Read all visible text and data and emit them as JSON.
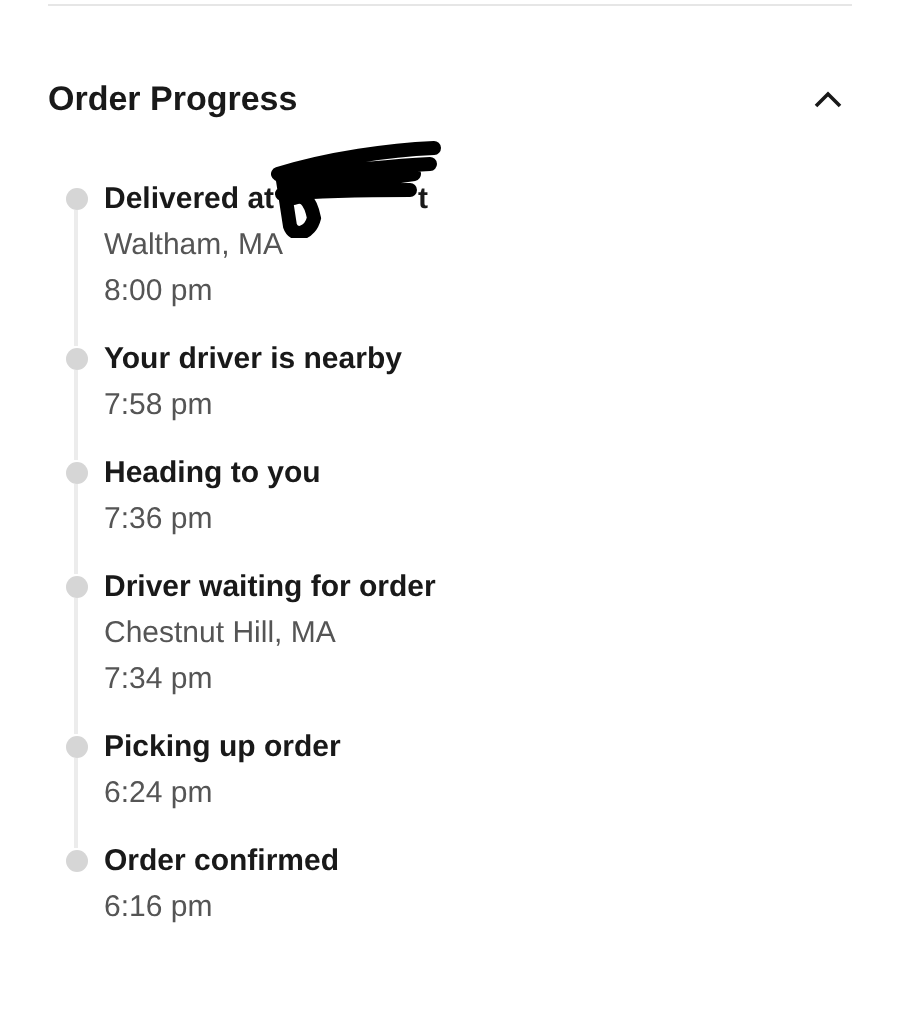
{
  "section": {
    "title": "Order Progress",
    "expanded": true
  },
  "steps": [
    {
      "title": "Delivered at",
      "redacted": true,
      "title_tail": "t",
      "lines": [
        "Waltham, MA",
        "8:00 pm"
      ]
    },
    {
      "title": "Your driver is nearby",
      "lines": [
        "7:58 pm"
      ]
    },
    {
      "title": "Heading to you",
      "lines": [
        "7:36 pm"
      ]
    },
    {
      "title": "Driver waiting for order",
      "lines": [
        "Chestnut Hill, MA",
        "7:34 pm"
      ]
    },
    {
      "title": "Picking up order",
      "lines": [
        "6:24 pm"
      ]
    },
    {
      "title": "Order confirmed",
      "lines": [
        "6:16 pm"
      ]
    }
  ]
}
